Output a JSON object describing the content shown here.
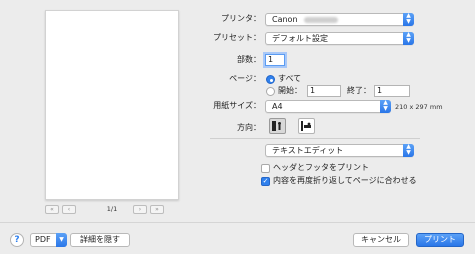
{
  "preview": {
    "page_count": "1/1",
    "first_label": "«",
    "prev_label": "‹",
    "next_label": "›",
    "last_label": "»"
  },
  "printer": {
    "label": "プリンタ：",
    "value": "Canon"
  },
  "preset": {
    "label": "プリセット：",
    "value": "デフォルト設定"
  },
  "copies": {
    "label": "部数：",
    "value": "1"
  },
  "pages": {
    "label": "ページ：",
    "all_label": "すべて",
    "from_label": "開始：",
    "from_value": "1",
    "to_label": "終了：",
    "to_value": "1"
  },
  "paper": {
    "label": "用紙サイズ：",
    "value": "A4",
    "dimensions": "210 x 297 mm"
  },
  "orientation": {
    "label": "方向："
  },
  "app_menu": {
    "value": "テキストエディット"
  },
  "options": {
    "header_footer": "ヘッダとフッタをプリント",
    "rewrap": "内容を再度折り返してページに合わせる"
  },
  "footer": {
    "help": "?",
    "pdf": "PDF",
    "hide_details": "詳細を隠す",
    "cancel": "キャンセル",
    "print": "プリント"
  },
  "colors": {
    "accent": "#2f80ed"
  }
}
